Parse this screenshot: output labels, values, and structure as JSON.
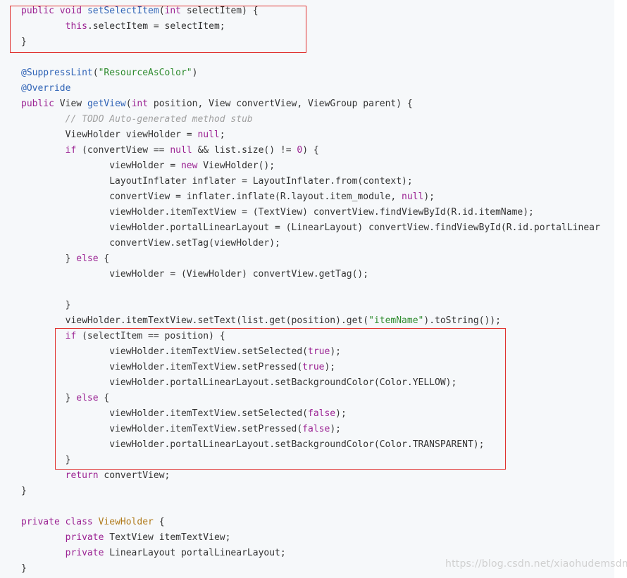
{
  "code_lines": [
    [
      [
        "kw",
        "public "
      ],
      [
        "kw",
        "void "
      ],
      [
        "fn",
        "setSelectItem"
      ],
      [
        "plain",
        "("
      ],
      [
        "kw",
        "int "
      ],
      [
        "plain",
        "selectItem) {"
      ]
    ],
    [
      [
        "plain",
        "        "
      ],
      [
        "kw",
        "this"
      ],
      [
        "plain",
        ".selectItem = selectItem;"
      ]
    ],
    [
      [
        "plain",
        "}"
      ]
    ],
    [
      [
        "plain",
        ""
      ]
    ],
    [
      [
        "ann",
        "@SuppressLint"
      ],
      [
        "plain",
        "("
      ],
      [
        "str",
        "\"ResourceAsColor\""
      ],
      [
        "plain",
        ")"
      ]
    ],
    [
      [
        "ann",
        "@Override"
      ]
    ],
    [
      [
        "kw",
        "public "
      ],
      [
        "plain",
        "View "
      ],
      [
        "fn",
        "getView"
      ],
      [
        "plain",
        "("
      ],
      [
        "kw",
        "int "
      ],
      [
        "plain",
        "position, View convertView, ViewGroup parent) {"
      ]
    ],
    [
      [
        "plain",
        "        "
      ],
      [
        "cm",
        "// TODO Auto-generated method stub"
      ]
    ],
    [
      [
        "plain",
        "        ViewHolder viewHolder = "
      ],
      [
        "lit",
        "null"
      ],
      [
        "plain",
        ";"
      ]
    ],
    [
      [
        "plain",
        "        "
      ],
      [
        "kw",
        "if "
      ],
      [
        "plain",
        "(convertView == "
      ],
      [
        "lit",
        "null "
      ],
      [
        "plain",
        "&& list.size() != "
      ],
      [
        "lit",
        "0"
      ],
      [
        "plain",
        ") {"
      ]
    ],
    [
      [
        "plain",
        "                viewHolder = "
      ],
      [
        "kw",
        "new "
      ],
      [
        "plain",
        "ViewHolder();"
      ]
    ],
    [
      [
        "plain",
        "                LayoutInflater inflater = LayoutInflater.from(context);"
      ]
    ],
    [
      [
        "plain",
        "                convertView = inflater.inflate(R.layout.item_module, "
      ],
      [
        "lit",
        "null"
      ],
      [
        "plain",
        ");"
      ]
    ],
    [
      [
        "plain",
        "                viewHolder.itemTextView = (TextView) convertView.findViewById(R.id.itemName);"
      ]
    ],
    [
      [
        "plain",
        "                viewHolder.portalLinearLayout = (LinearLayout) convertView.findViewById(R.id.portalLinear"
      ]
    ],
    [
      [
        "plain",
        "                convertView.setTag(viewHolder);"
      ]
    ],
    [
      [
        "plain",
        "        } "
      ],
      [
        "kw",
        "else "
      ],
      [
        "plain",
        "{"
      ]
    ],
    [
      [
        "plain",
        "                viewHolder = (ViewHolder) convertView.getTag();"
      ]
    ],
    [
      [
        "plain",
        ""
      ]
    ],
    [
      [
        "plain",
        "        }"
      ]
    ],
    [
      [
        "plain",
        "        viewHolder.itemTextView.setText(list.get(position).get("
      ],
      [
        "str",
        "\"itemName\""
      ],
      [
        "plain",
        ").toString());"
      ]
    ],
    [
      [
        "plain",
        "        "
      ],
      [
        "kw",
        "if "
      ],
      [
        "plain",
        "(selectItem == position) {"
      ]
    ],
    [
      [
        "plain",
        "                viewHolder.itemTextView.setSelected("
      ],
      [
        "lit",
        "true"
      ],
      [
        "plain",
        ");"
      ]
    ],
    [
      [
        "plain",
        "                viewHolder.itemTextView.setPressed("
      ],
      [
        "lit",
        "true"
      ],
      [
        "plain",
        ");"
      ]
    ],
    [
      [
        "plain",
        "                viewHolder.portalLinearLayout.setBackgroundColor(Color.YELLOW);"
      ]
    ],
    [
      [
        "plain",
        "        } "
      ],
      [
        "kw",
        "else "
      ],
      [
        "plain",
        "{"
      ]
    ],
    [
      [
        "plain",
        "                viewHolder.itemTextView.setSelected("
      ],
      [
        "lit",
        "false"
      ],
      [
        "plain",
        ");"
      ]
    ],
    [
      [
        "plain",
        "                viewHolder.itemTextView.setPressed("
      ],
      [
        "lit",
        "false"
      ],
      [
        "plain",
        ");"
      ]
    ],
    [
      [
        "plain",
        "                viewHolder.portalLinearLayout.setBackgroundColor(Color.TRANSPARENT);"
      ]
    ],
    [
      [
        "plain",
        "        }"
      ]
    ],
    [
      [
        "plain",
        "        "
      ],
      [
        "kw",
        "return "
      ],
      [
        "plain",
        "convertView;"
      ]
    ],
    [
      [
        "plain",
        "}"
      ]
    ],
    [
      [
        "plain",
        ""
      ]
    ],
    [
      [
        "kw",
        "private "
      ],
      [
        "kw",
        "class "
      ],
      [
        "cls",
        "ViewHolder "
      ],
      [
        "plain",
        "{"
      ]
    ],
    [
      [
        "plain",
        "        "
      ],
      [
        "kw",
        "private "
      ],
      [
        "plain",
        "TextView itemTextView;"
      ]
    ],
    [
      [
        "plain",
        "        "
      ],
      [
        "kw",
        "private "
      ],
      [
        "plain",
        "LinearLayout portalLinearLayout;"
      ]
    ],
    [
      [
        "plain",
        "}"
      ]
    ]
  ],
  "watermark": "https://blog.csdn.net/xiaohudemsdn",
  "colors": {
    "background": "#f6f8fa",
    "keyword": "#9b2393",
    "function": "#2f63b6",
    "string": "#2e8b2e",
    "comment": "#a0a0a0",
    "class_name": "#b07a1a",
    "highlight_border": "#e0322f"
  }
}
